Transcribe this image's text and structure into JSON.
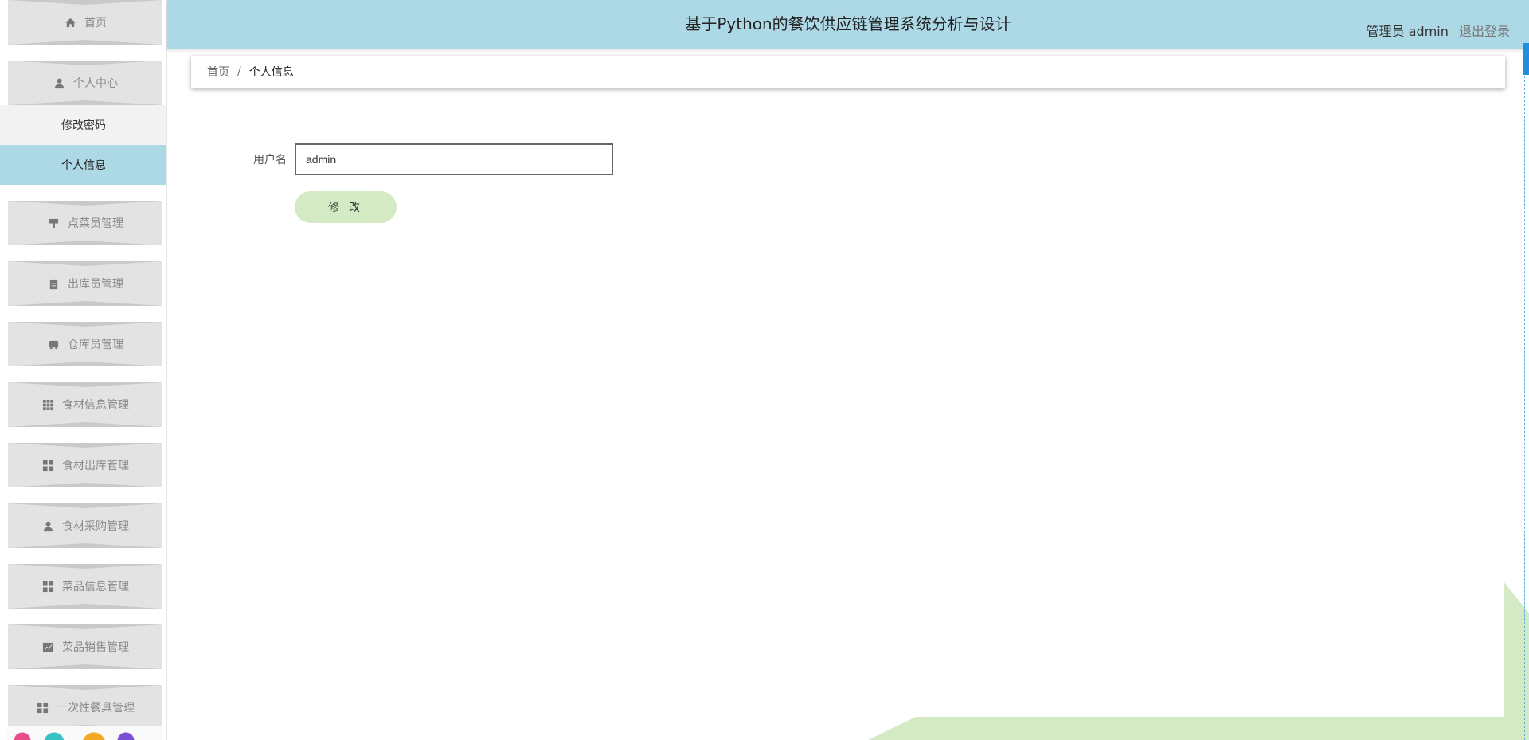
{
  "header": {
    "title": "基于Python的餐饮供应链管理系统分析与设计",
    "user_label": "管理员 admin",
    "logout_label": "退出登录"
  },
  "sidebar": {
    "items": [
      {
        "label": "首页",
        "icon": "home-icon"
      },
      {
        "label": "个人中心",
        "icon": "user-icon"
      },
      {
        "label": "点菜员管理",
        "icon": "brush-icon"
      },
      {
        "label": "出库员管理",
        "icon": "clipboard-icon"
      },
      {
        "label": "仓库员管理",
        "icon": "tray-icon"
      },
      {
        "label": "食材信息管理",
        "icon": "grid-icon"
      },
      {
        "label": "食材出库管理",
        "icon": "dashboard-icon"
      },
      {
        "label": "食材采购管理",
        "icon": "user-icon"
      },
      {
        "label": "菜品信息管理",
        "icon": "dashboard-icon"
      },
      {
        "label": "菜品销售管理",
        "icon": "chart-icon"
      },
      {
        "label": "一次性餐具管理",
        "icon": "dashboard-icon"
      }
    ],
    "submenu": [
      {
        "label": "修改密码"
      },
      {
        "label": "个人信息"
      }
    ]
  },
  "breadcrumb": {
    "home": "首页",
    "separator": "/",
    "current": "个人信息"
  },
  "form": {
    "username_label": "用户名",
    "username_value": "admin",
    "submit_label": "修 改"
  },
  "colors": {
    "header_bg": "#add8e6",
    "active_menu_bg": "#add8e6",
    "button_bg": "#d4eac4",
    "menu_bg": "#e3e3e3"
  }
}
